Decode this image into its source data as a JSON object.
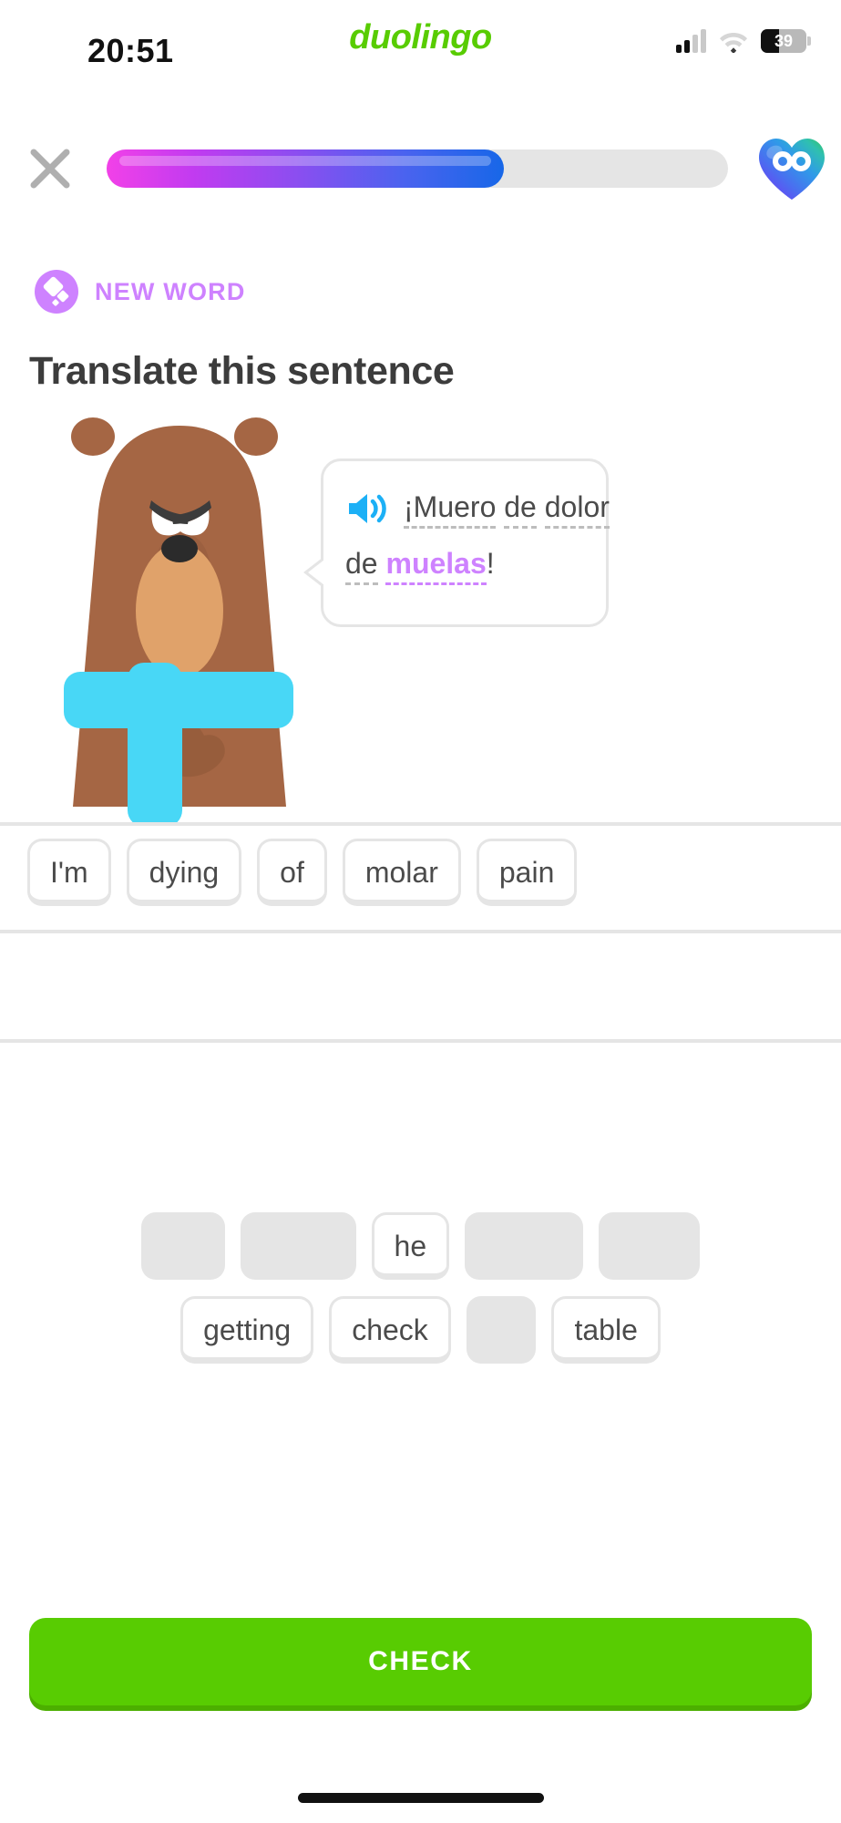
{
  "status_bar": {
    "time": "20:51",
    "brand": "duolingo",
    "battery_percent": "39",
    "signal_icon": "signal-bars-icon",
    "wifi_icon": "wifi-icon",
    "battery_icon": "battery-icon"
  },
  "top_bar": {
    "close_icon": "close-x-icon",
    "progress_percent": 64,
    "hearts_icon": "heart-infinity-icon"
  },
  "lesson": {
    "badge_label": "NEW WORD",
    "badge_icon": "new-word-diamond-icon",
    "badge_color": "#CE82FF",
    "heading": "Translate this sentence"
  },
  "character": {
    "name": "falstaff-bear-character",
    "fur_color": "#A56644",
    "muzzle_color": "#E0A26A",
    "scarf_color": "#48D7F6"
  },
  "prompt": {
    "speaker_icon": "speaker-volume-icon",
    "speaker_color": "#1CB0F6",
    "line1": [
      {
        "text": "¡Muero",
        "new_word": false,
        "dashed": true
      },
      {
        "text": "de",
        "new_word": false,
        "dashed": true
      },
      {
        "text": "dolor",
        "new_word": false,
        "dashed": true
      }
    ],
    "line2": [
      {
        "text": "de",
        "new_word": false,
        "dashed": true
      },
      {
        "text": "muelas",
        "new_word": true,
        "dashed": true
      },
      {
        "text": "!",
        "new_word": false,
        "dashed": false
      }
    ],
    "full_sentence": "¡Muero de dolor de muelas!"
  },
  "answer_lines": [
    {
      "tiles": [
        "I'm",
        "dying",
        "of",
        "molar",
        "pain"
      ]
    },
    {
      "tiles": []
    },
    {
      "tiles": []
    }
  ],
  "word_bank": {
    "rows": [
      [
        {
          "label": "I'm",
          "used": true
        },
        {
          "label": "dying",
          "used": true
        },
        {
          "label": "he",
          "used": false
        },
        {
          "label": "molar",
          "used": true
        },
        {
          "label": "pain",
          "used": true
        }
      ],
      [
        {
          "label": "getting",
          "used": false
        },
        {
          "label": "check",
          "used": false
        },
        {
          "label": "of",
          "used": true
        },
        {
          "label": "table",
          "used": false
        }
      ]
    ]
  },
  "footer": {
    "check_label": "CHECK",
    "check_color": "#58CC02"
  }
}
